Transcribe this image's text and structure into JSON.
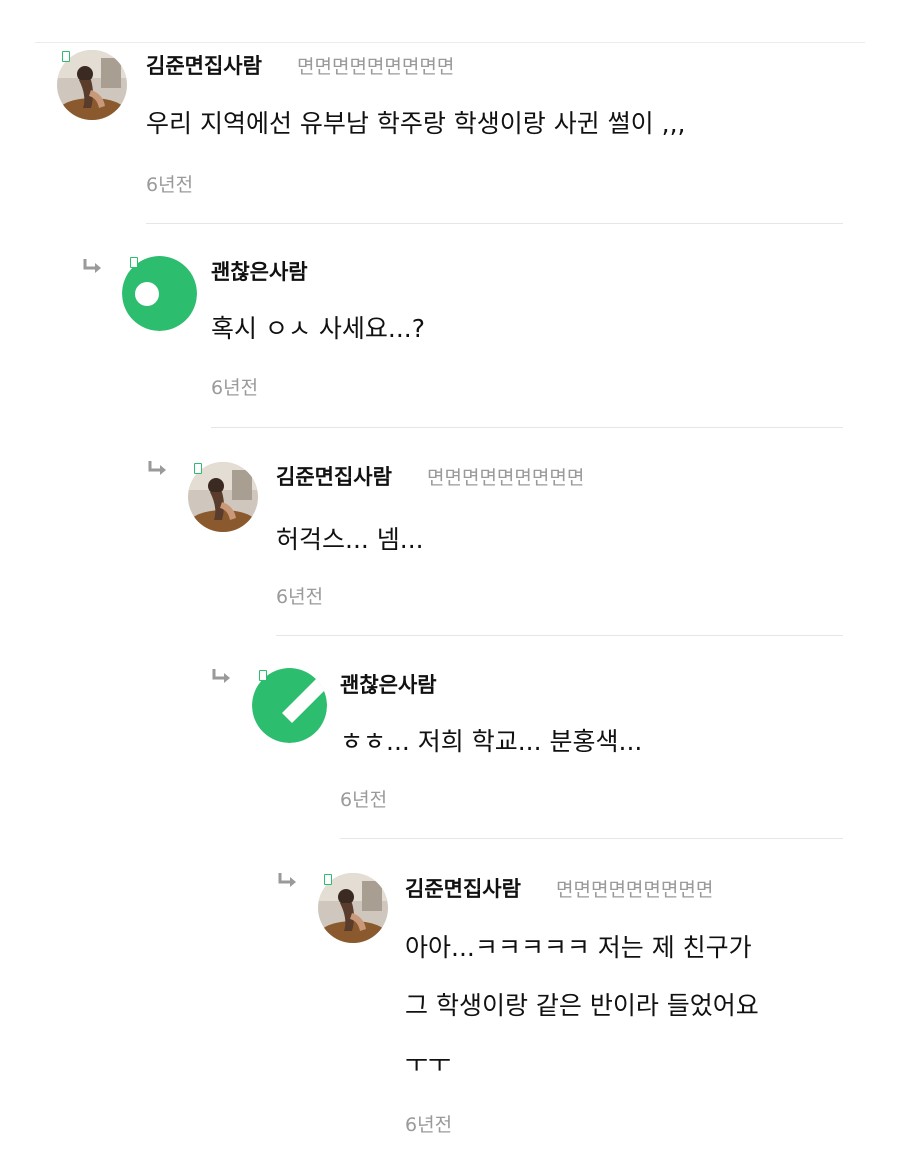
{
  "comments": [
    {
      "author": "김준면집사람",
      "subname": "면면면면면면면면면",
      "lines": [
        "우리 지역에선 유부남 학주랑 학생이랑 사귄 썰이 ,,,"
      ],
      "time": "6년전",
      "avatar": "photo"
    },
    {
      "author": "괜찮은사람",
      "subname": "",
      "lines": [
        "혹시 ㅇㅅ 사세요...?"
      ],
      "time": "6년전",
      "avatar": "green-ring"
    },
    {
      "author": "김준면집사람",
      "subname": "면면면면면면면면면",
      "lines": [
        "허걱스... 넴..."
      ],
      "time": "6년전",
      "avatar": "photo"
    },
    {
      "author": "괜찮은사람",
      "subname": "",
      "lines": [
        "ㅎㅎ... 저희 학교... 분홍색..."
      ],
      "time": "6년전",
      "avatar": "green-notch"
    },
    {
      "author": "김준면집사람",
      "subname": "면면면면면면면면면",
      "lines": [
        "아아...ㅋㅋㅋㅋㅋ 저는 제 친구가",
        "그 학생이랑 같은 반이라 들었어요",
        "ㅜㅜ"
      ],
      "time": "6년전",
      "avatar": "photo"
    }
  ],
  "icons": {
    "reply": "reply-arrow-icon",
    "badge": "level-badge-icon"
  },
  "colors": {
    "accent_green": "#2dbd6e",
    "meta_gray": "#9a9a9a",
    "divider": "#e6e6e6"
  }
}
